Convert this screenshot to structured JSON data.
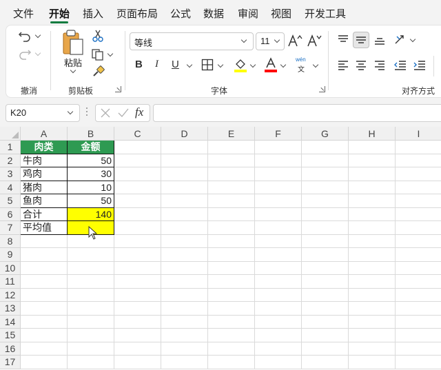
{
  "menu": {
    "tabs": [
      "文件",
      "开始",
      "插入",
      "页面布局",
      "公式",
      "数据",
      "审阅",
      "视图",
      "开发工具"
    ],
    "active_index": 1
  },
  "ribbon": {
    "groups": {
      "undo": "撤消",
      "clipboard": "剪贴板",
      "font": "字体",
      "alignment": "对齐方式"
    },
    "paste_label": "粘贴",
    "font_name": "等线",
    "font_size": "11",
    "bold": "B",
    "italic": "I",
    "underline": "U",
    "phonetic_top": "wén",
    "phonetic_bottom": "文",
    "font_color": "#ff0000",
    "fill_color": "#ffff00"
  },
  "formula_bar": {
    "name_box": "K20",
    "fx": "fx",
    "formula": ""
  },
  "sheet": {
    "columns": [
      "A",
      "B",
      "C",
      "D",
      "E",
      "F",
      "G",
      "H",
      "I"
    ],
    "rows": [
      "1",
      "2",
      "3",
      "4",
      "5",
      "6",
      "7",
      "8",
      "9",
      "10",
      "11",
      "12",
      "13",
      "14",
      "15",
      "16",
      "17"
    ],
    "header": [
      "肉类",
      "金额"
    ],
    "data": [
      [
        "牛肉",
        "50"
      ],
      [
        "鸡肉",
        "30"
      ],
      [
        "猪肉",
        "10"
      ],
      [
        "鱼肉",
        "50"
      ],
      [
        "合计",
        "140"
      ],
      [
        "平均值",
        ""
      ]
    ],
    "header_color": "#2e9a52",
    "highlight_color": "#ffff00"
  }
}
